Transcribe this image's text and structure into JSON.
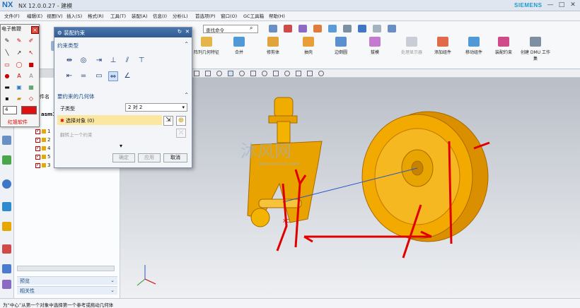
{
  "window": {
    "logo": "NX",
    "title": "NX 12.0.0.27 - 建模",
    "brand": "SIEMENS",
    "min": "—",
    "max": "□",
    "close": "✕"
  },
  "menubar": {
    "items": [
      "文件(F)",
      "编辑(E)",
      "视图(V)",
      "插入(S)",
      "格式(R)",
      "工具(T)",
      "装配(A)",
      "信息(I)",
      "分析(L)",
      "首选项(P)",
      "窗口(O)",
      "GC工具箱",
      "帮助(H)"
    ]
  },
  "ribbon": {
    "search_placeholder": "查找命令",
    "buttons": [
      "拉",
      "阵列几何特征",
      "合并",
      "修剪体",
      "抽壳",
      "边倒圆",
      "拔模",
      "处理显示器",
      "添加组件",
      "移动组件",
      "装配约束",
      "创建 DMU 工作集"
    ]
  },
  "toolbox": {
    "title": "电子教鞭",
    "size": "4",
    "brand": "红姐软件",
    "close_icon": "close-icon",
    "color": "#e01010"
  },
  "dialog": {
    "title": "装配约束",
    "section_type": "约束类型",
    "section_geom": "要约束的几何体",
    "subtype_label": "子类型",
    "subtype_value": "2 对 2",
    "select_label": "选择对象 (0)",
    "reverse_label": "翻转上一个约束",
    "ok": "确定",
    "apply": "应用",
    "cancel": "取消"
  },
  "navtree": {
    "column": "件名",
    "root": "asm1",
    "items": [
      "1",
      "2",
      "4",
      "5",
      "3"
    ],
    "preview": "预览",
    "relation": "相关性"
  },
  "viewport": {
    "watermark": "沐风网",
    "watermark_url": "www.mfcad.com",
    "axis_label": "XC",
    "annotation_color": "#e00000"
  },
  "status": {
    "text": "为“中心”从第一个对象中选择第一个参考或拖动几何体"
  },
  "colors": {
    "accent": "#2f5a92",
    "part": "#e6a800"
  }
}
